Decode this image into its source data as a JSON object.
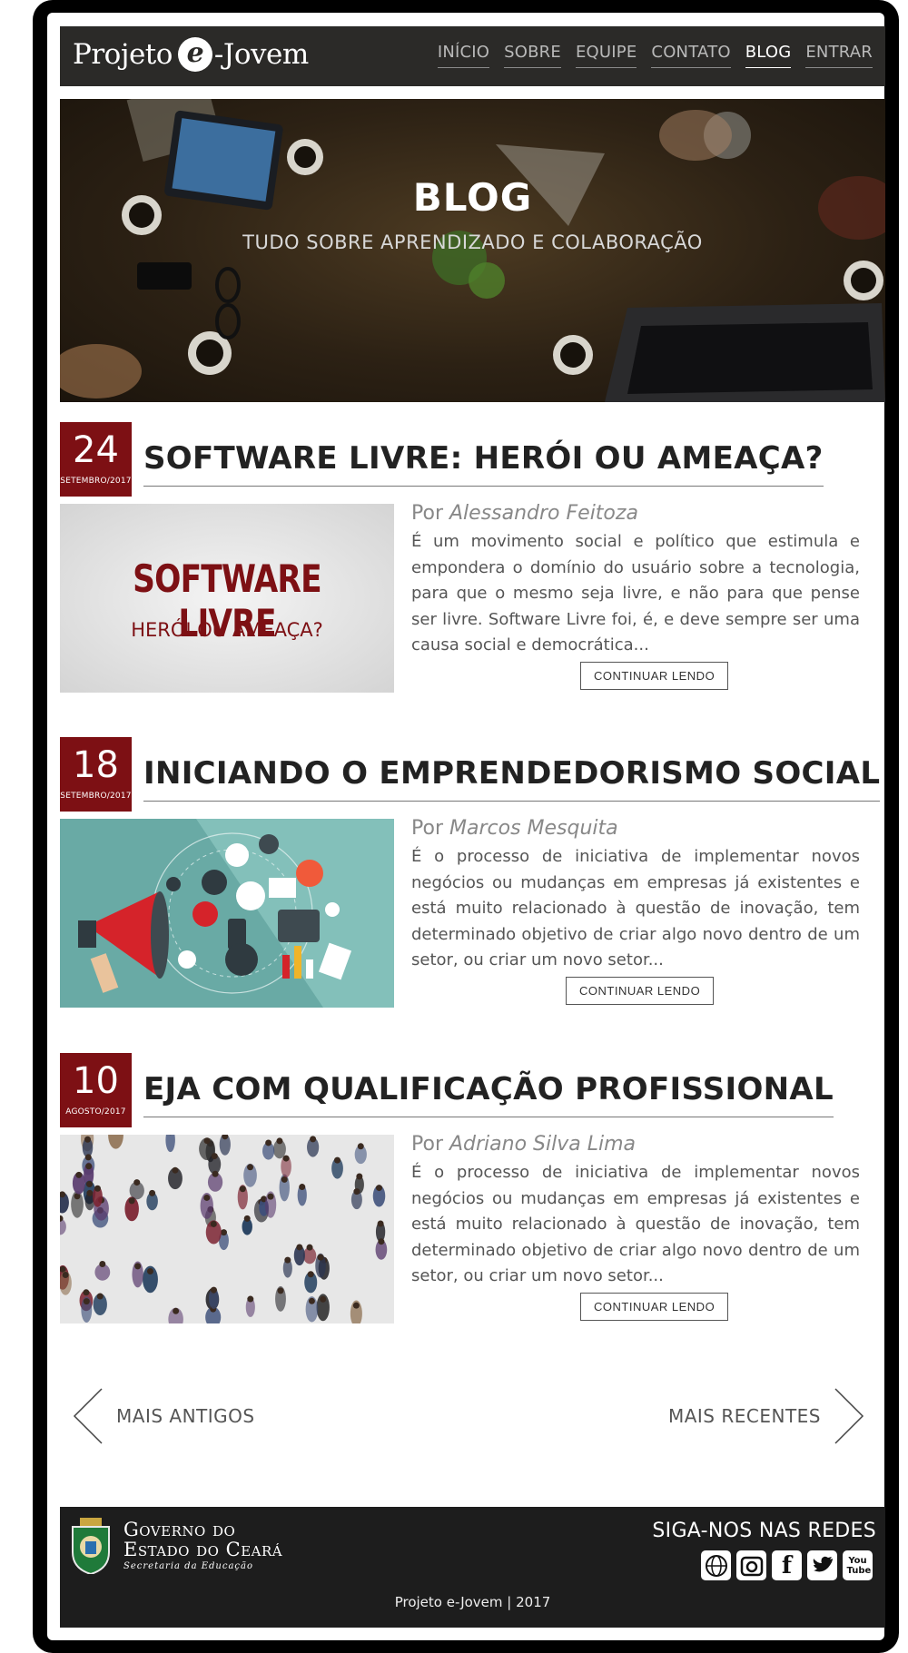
{
  "header": {
    "logo_prefix": "Projeto",
    "logo_e": "e",
    "logo_suffix": "-Jovem",
    "nav": [
      {
        "label": "INÍCIO",
        "active": false
      },
      {
        "label": "SOBRE",
        "active": false
      },
      {
        "label": "EQUIPE",
        "active": false
      },
      {
        "label": "CONTATO",
        "active": false
      },
      {
        "label": "BLOG",
        "active": true
      },
      {
        "label": "ENTRAR",
        "active": false
      }
    ]
  },
  "hero": {
    "title": "BLOG",
    "subtitle": "TUDO SOBRE APRENDIZADO E COLABORAÇÃO"
  },
  "posts": [
    {
      "day": "24",
      "month": "SETEMBRO/2017",
      "title": "SOFTWARE LIVRE: HERÓI OU AMEAÇA?",
      "author_prefix": "Por",
      "author": "Alessandro Feitoza",
      "excerpt": "É um movimento social e político que estimula e empondera o domínio do usuário sobre a tecnologia, para que o mesmo seja livre, e não para que pense ser livre. Software Livre foi, é, e deve sempre ser uma causa social e democrática...",
      "button": "CONTINUAR LENDO",
      "thumb_title": "SOFTWARE LIVRE",
      "thumb_sub": "HERÓI OU AMEAÇA?"
    },
    {
      "day": "18",
      "month": "SETEMBRO/2017",
      "title": "INICIANDO O EMPRENDEDORISMO SOCIAL",
      "author_prefix": "Por",
      "author": "Marcos Mesquita",
      "excerpt": "É o processo de iniciativa de implementar novos negócios ou mudanças em empresas já existentes e está muito relacionado à questão de inovação, tem determinado objetivo de criar algo novo dentro de um setor, ou criar um novo setor...",
      "button": "CONTINUAR LENDO"
    },
    {
      "day": "10",
      "month": "AGOSTO/2017",
      "title": "EJA COM QUALIFICAÇÃO PROFISSIONAL",
      "author_prefix": "Por",
      "author": "Adriano Silva Lima",
      "excerpt": "É o processo de iniciativa de implementar novos negócios ou mudanças em empresas já existentes e está muito relacionado à questão de inovação, tem determinado objetivo de criar algo novo dentro de um setor, ou criar um novo setor...",
      "button": "CONTINUAR LENDO"
    }
  ],
  "pager": {
    "older": "MAIS ANTIGOS",
    "newer": "MAIS RECENTES"
  },
  "footer": {
    "gov_line1": "Governo do",
    "gov_line2": "Estado do Ceará",
    "gov_line3": "Secretaria da Educação",
    "follow": "SIGA-NOS NAS REDES",
    "socials": [
      "www-icon",
      "instagram-icon",
      "facebook-icon",
      "twitter-icon",
      "youtube-icon"
    ],
    "youtube_label": "You Tube",
    "copyright": "Projeto e-Jovem | 2017"
  },
  "colors": {
    "accent": "#7d1014",
    "header_bg": "#2b2a28",
    "footer_bg": "#1d1d1d"
  }
}
